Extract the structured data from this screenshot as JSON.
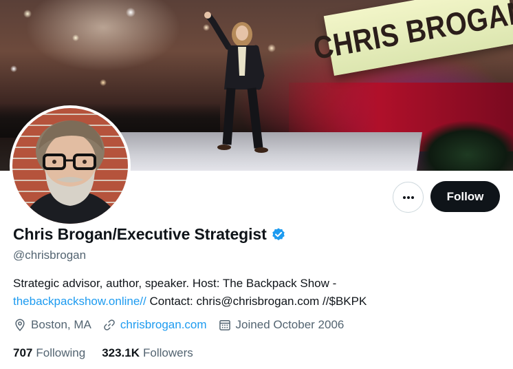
{
  "banner": {
    "sign_text": "CHRIS BROGAN"
  },
  "actions": {
    "more_icon": "more-horizontal-icon",
    "follow_label": "Follow"
  },
  "profile": {
    "display_name": "Chris Brogan/Executive Strategist",
    "verified_icon": "verified-badge-icon",
    "handle": "@chrisbrogan",
    "bio_line1": "Strategic advisor, author, speaker. Host: The Backpack Show -",
    "bio_link": "thebackpackshow.online//",
    "bio_line2_rest": " Contact: chris@chrisbrogan.com //$BKPK",
    "location": "Boston, MA",
    "location_icon": "location-pin-icon",
    "website": "chrisbrogan.com",
    "website_icon": "link-icon",
    "joined": "Joined October 2006",
    "joined_icon": "calendar-icon"
  },
  "stats": {
    "following_count": "707",
    "following_label": "Following",
    "followers_count": "323.1K",
    "followers_label": "Followers"
  },
  "colors": {
    "accent": "#1d9bf0",
    "text_primary": "#0f1419",
    "text_secondary": "#536471",
    "follow_button_bg": "#0f1419"
  }
}
